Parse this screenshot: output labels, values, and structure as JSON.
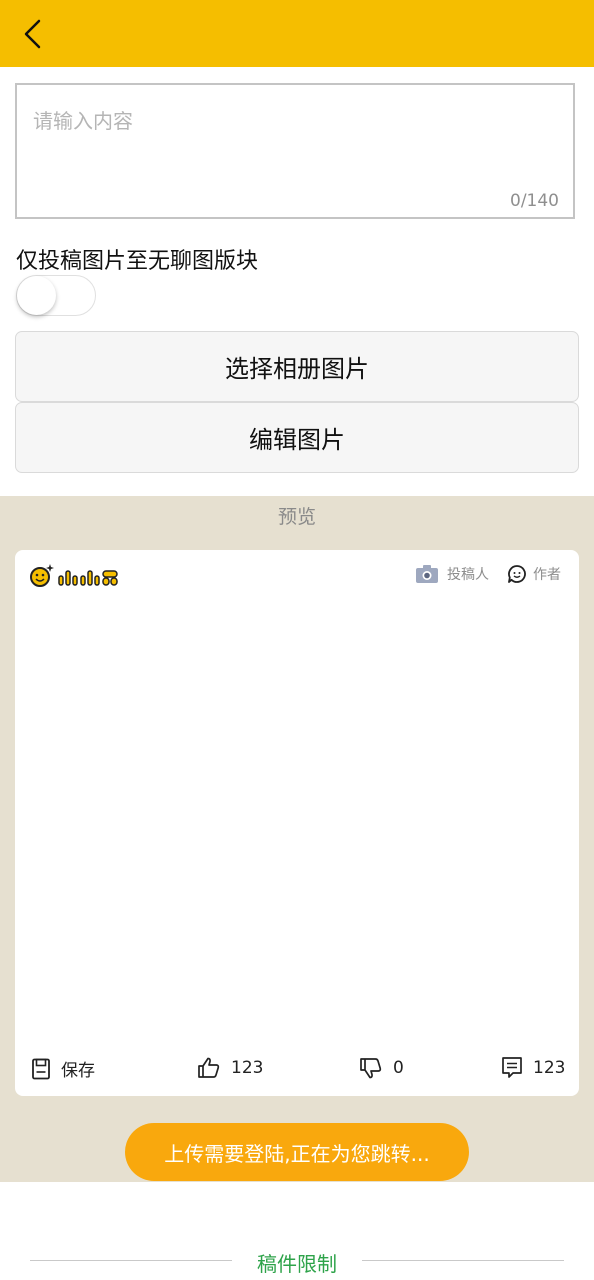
{
  "header": {
    "back_icon": "chevron-left-icon",
    "color": "#f5be00"
  },
  "editor": {
    "placeholder": "请输入内容",
    "counter": "0/140"
  },
  "toggle": {
    "label": "仅投稿图片至无聊图版块",
    "checked": false
  },
  "buttons": {
    "select_album": "选择相册图片",
    "edit_image": "编辑图片"
  },
  "preview": {
    "label": "预览",
    "card": {
      "submitter_label": "投稿人",
      "author_label": "作者",
      "actions": {
        "save": "保存",
        "likes": "123",
        "dislikes": "0",
        "comments": "123"
      }
    }
  },
  "toast": {
    "text": "上传需要登陆,正在为您跳转..."
  },
  "footer": {
    "limit_label": "稿件限制",
    "accent": "#2ea34a"
  }
}
